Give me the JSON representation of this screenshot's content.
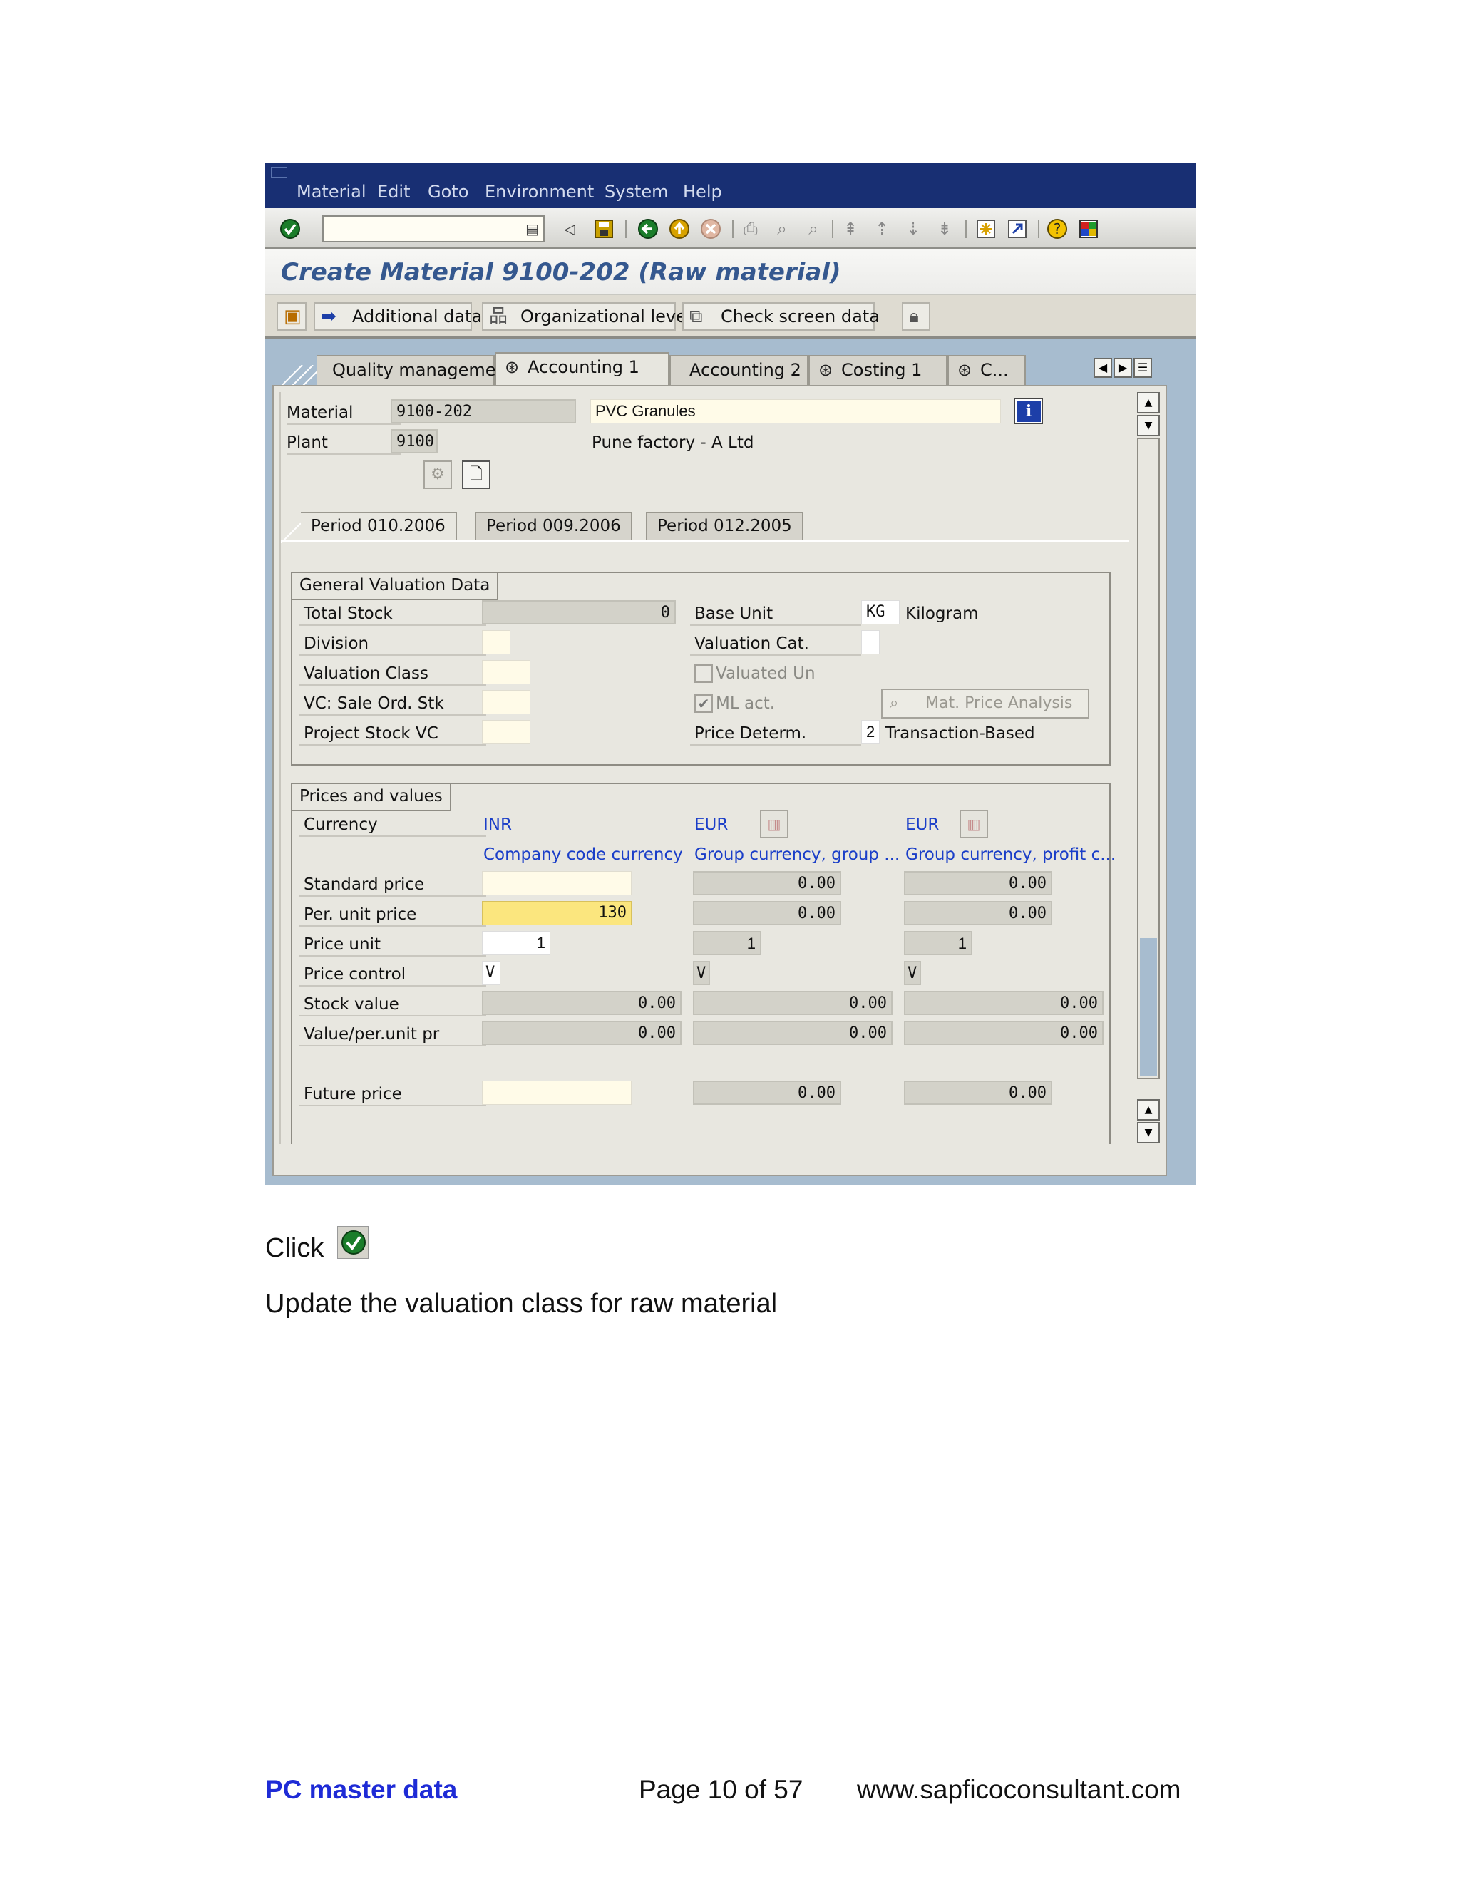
{
  "menu": [
    "Material",
    "Edit",
    "Goto",
    "Environment",
    "System",
    "Help"
  ],
  "title": "Create Material 9100-202 (Raw material)",
  "app_buttons": {
    "additional": "Additional data",
    "org_levels": "Organizational levels",
    "check": "Check screen data"
  },
  "tabs": {
    "qm": "Quality management",
    "acc1": "Accounting 1",
    "acc2": "Accounting 2",
    "cost1": "Costing 1",
    "c": "C..."
  },
  "header": {
    "material_label": "Material",
    "material_value": "9100-202",
    "material_desc": "PVC Granules",
    "plant_label": "Plant",
    "plant_value": "9100",
    "plant_desc": "Pune factory -  A Ltd"
  },
  "periods": [
    "Period 010.2006",
    "Period 009.2006",
    "Period 012.2005"
  ],
  "general": {
    "title": "General Valuation Data",
    "total_stock_label": "Total Stock",
    "total_stock": "0",
    "division_label": "Division",
    "valuation_class_label": "Valuation Class",
    "vc_sales_label": "VC: Sale Ord. Stk",
    "project_stock_label": "Project Stock VC",
    "base_unit_label": "Base Unit",
    "base_unit": "KG",
    "base_unit_text": "Kilogram",
    "valuation_cat_label": "Valuation Cat.",
    "valuated_un_label": "Valuated Un",
    "ml_act_label": "ML act.",
    "mat_price_btn": "Mat. Price Analysis",
    "price_determ_label": "Price Determ.",
    "price_determ_value": "2",
    "price_determ_text": "Transaction-Based"
  },
  "prices": {
    "title": "Prices and values",
    "currency_label": "Currency",
    "currencies": [
      "INR",
      "EUR",
      "EUR"
    ],
    "currency_types": [
      "Company code currency",
      "Group currency, group ...",
      "Group currency, profit c..."
    ],
    "standard_price_label": "Standard price",
    "per_unit_label": "Per. unit price",
    "price_unit_label": "Price unit",
    "price_control_label": "Price control",
    "stock_value_label": "Stock value",
    "value_per_unit_label": "Value/per.unit pr",
    "future_price_label": "Future price",
    "standard": [
      "",
      "0.00",
      "0.00"
    ],
    "per_unit": [
      "130",
      "0.00",
      "0.00"
    ],
    "price_unit": [
      "1",
      "1",
      "1"
    ],
    "price_control": [
      "V",
      "V",
      "V"
    ],
    "stock_value": [
      "0.00",
      "0.00",
      "0.00"
    ],
    "value_per_unit": [
      "0.00",
      "0.00",
      "0.00"
    ],
    "future": [
      "",
      "0.00",
      "0.00"
    ]
  },
  "instruction_click": "Click",
  "instruction_update": "Update the valuation class for raw material",
  "footer": {
    "left": "PC master data",
    "center": "Page 10 of 57",
    "right": "www.sapficoconsultant.com"
  }
}
